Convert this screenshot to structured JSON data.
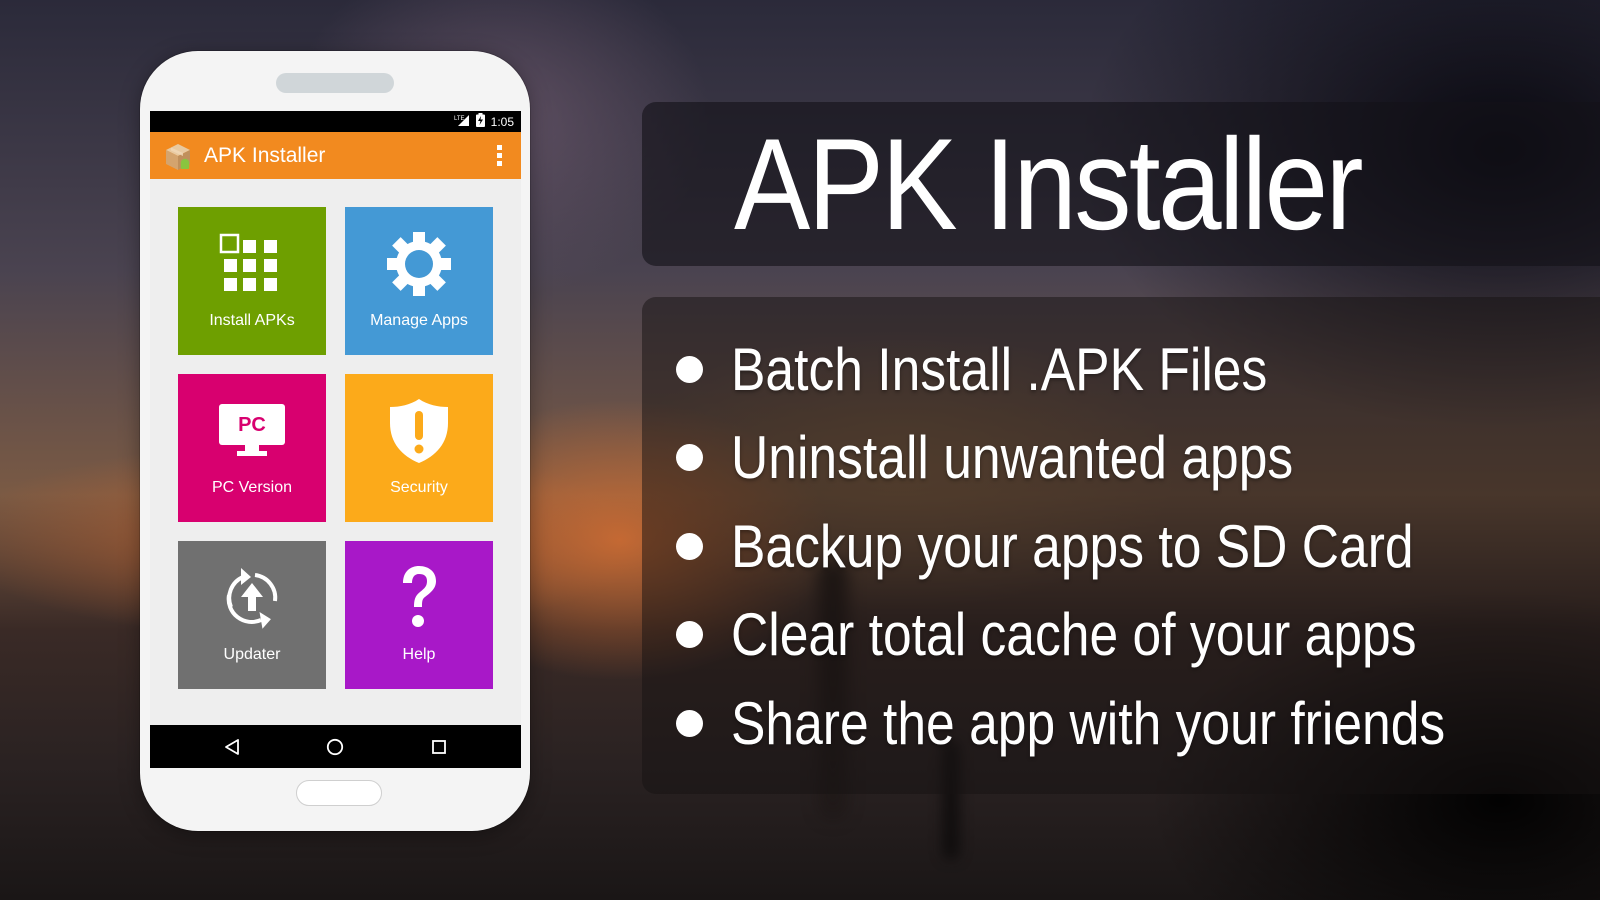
{
  "phone": {
    "status_bar": {
      "network_icon": "lte-signal-icon",
      "battery_icon": "battery-charging-icon",
      "time": "1:05"
    },
    "app_bar": {
      "logo_icon": "package-box-android-icon",
      "title": "APK Installer",
      "menu_icon": "overflow-menu-icon"
    },
    "tiles": [
      {
        "label": "Install APKs",
        "icon": "grid-apps-icon",
        "color": "#6e9f00"
      },
      {
        "label": "Manage Apps",
        "icon": "gear-icon",
        "color": "#4499d5"
      },
      {
        "label": "PC Version",
        "icon": "monitor-pc-icon",
        "icon_text": "PC",
        "color": "#d8006f"
      },
      {
        "label": "Security",
        "icon": "shield-alert-icon",
        "color": "#fcaa1a"
      },
      {
        "label": "Updater",
        "icon": "update-arrows-icon",
        "color": "#707070"
      },
      {
        "label": "Help",
        "icon": "question-mark-icon",
        "color": "#a818c8"
      }
    ],
    "nav_bar": {
      "back_icon": "back-triangle-icon",
      "home_icon": "home-circle-icon",
      "recents_icon": "recents-square-icon"
    },
    "colors": {
      "app_bar": "#f28a1f",
      "screen_bg": "#eeeeee"
    }
  },
  "promo": {
    "title": "APK Installer",
    "features": [
      "Batch Install .APK Files",
      "Uninstall unwanted apps",
      "Backup your apps to SD Card",
      "Clear total cache of your apps",
      "Share the app with your friends"
    ]
  }
}
